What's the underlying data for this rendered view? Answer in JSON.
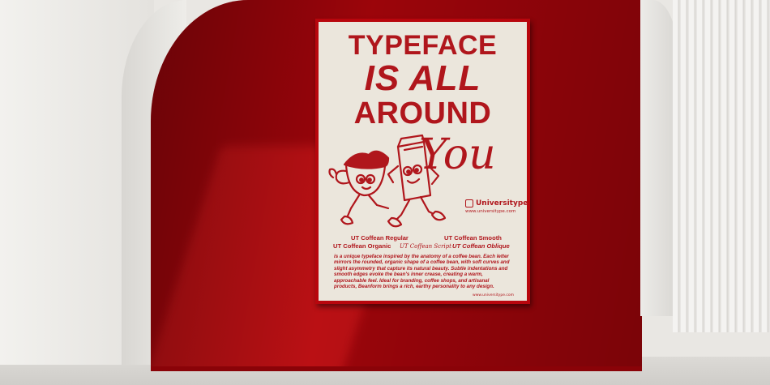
{
  "poster": {
    "headline": [
      "TYPEFACE",
      "IS ALL",
      "AROUND"
    ],
    "script_word": "You",
    "brand": {
      "name": "Universitype",
      "url": "www.universitype.com"
    },
    "font_names": {
      "regular": "UT Coffean Regular",
      "smooth": "UT Coffean Smooth",
      "organic": "UT Coffean Organic",
      "script": "UT Coffean Script",
      "oblique": "UT Coffean Oblique"
    },
    "description": "is a unique typeface inspired by the anatomy of a coffee bean. Each letter mirrors the rounded, organic shape of a coffee bean, with soft curves and slight asymmetry that capture its natural beauty. Subtle indentations and smooth edges evoke the bean's inner crease, creating a warm, approachable feel. Ideal for branding, coffee shops, and artisanal products, Beanform brings a rich, earthy personality to any design.",
    "footer_url": "www.universitype.com"
  },
  "colors": {
    "wall_red": "#a4050b",
    "poster_ink": "#b0161c",
    "paper": "#ebe6dc"
  },
  "icons": [
    "coffee-cup-mascot-icon",
    "coffee-bag-mascot-icon",
    "universitype-logo-icon"
  ]
}
